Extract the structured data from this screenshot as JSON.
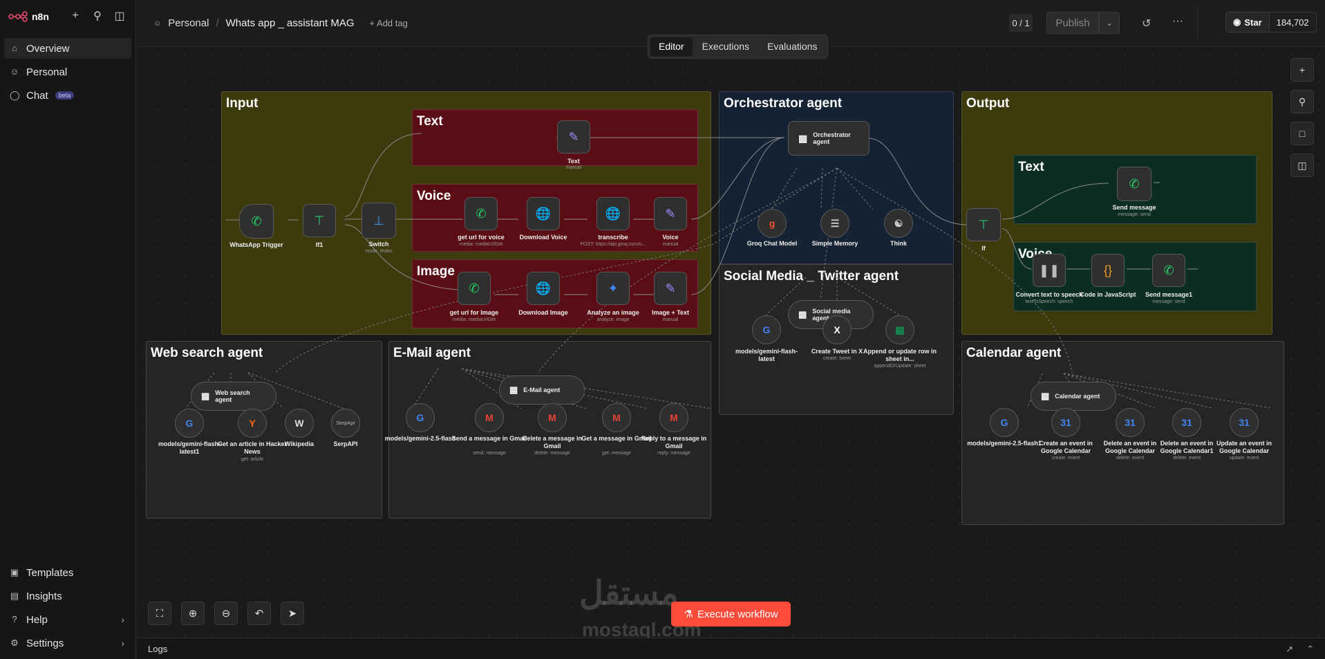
{
  "app": {
    "logo_text": "n8n"
  },
  "sidebar": {
    "items": [
      {
        "label": "Overview"
      },
      {
        "label": "Personal"
      },
      {
        "label": "Chat",
        "badge": "beta"
      }
    ],
    "bottom": [
      {
        "label": "Templates"
      },
      {
        "label": "Insights"
      },
      {
        "label": "Help"
      },
      {
        "label": "Settings"
      }
    ]
  },
  "header": {
    "project": "Personal",
    "workflow_title": "Whats app _ assistant MAG",
    "add_tag": "+ Add tag",
    "counter": "0 / 1",
    "publish": "Publish",
    "github_star": "Star",
    "github_count": "184,702"
  },
  "tabs": [
    {
      "label": "Editor"
    },
    {
      "label": "Executions"
    },
    {
      "label": "Evaluations"
    }
  ],
  "canvas": {
    "sections": {
      "input": "Input",
      "text": "Text",
      "voice": "Voice",
      "image": "Image",
      "orchestrator": "Orchestrator agent",
      "output": "Output",
      "out_text": "Text",
      "out_voice": "Voice",
      "social": "Social Media _ Twitter agent",
      "web": "Web search agent",
      "email": "E-Mail agent",
      "calendar": "Calendar agent"
    },
    "nodes": {
      "trigger": "WhatsApp Trigger",
      "if1": "If1",
      "switch": "Switch",
      "switch_sub": "mode: Rules",
      "text_node": "Text",
      "text_sub": "manual",
      "get_voice": "get url for voice",
      "get_voice_sub": "media: mediaUrlGet",
      "download_voice": "Download Voice",
      "transcribe": "transcribe",
      "transcribe_sub": "POST: https://api.groq.com/o...",
      "voice_node": "Voice",
      "voice_sub": "manual",
      "get_image": "get url for Image",
      "get_image_sub": "media: mediaUrlGet",
      "download_image": "Download Image",
      "analyze_image": "Analyze an image",
      "analyze_sub": "analyze: image",
      "image_text": "Image + Text",
      "image_text_sub": "manual",
      "orchestrator": "Orchestrator agent",
      "groq": "Groq Chat Model",
      "memory": "Simple Memory",
      "think": "Think",
      "out_if": "If",
      "send_message": "Send message",
      "send_message_sub": "message: send",
      "tts": "Convert text to speech",
      "tts_sub": "textToSpeech: speech",
      "code_js": "Code in JavaScript",
      "send_message1": "Send message1",
      "send_message1_sub": "message: send",
      "social_agent": "Social media agent",
      "social_model": "models/gemini-flash-latest",
      "tweet": "Create Tweet in X",
      "tweet_sub": "create: tweet",
      "sheet": "Append or update row in sheet in...",
      "sheet_sub": "appendOrUpdate: sheet",
      "web_agent": "Web search agent",
      "web_model": "models/gemini-flash-latest1",
      "hn": "Get an article in Hacker News",
      "hn_sub": "get: article",
      "wiki": "Wikipedia",
      "serp": "SerpAPI",
      "email_agent": "E-Mail agent",
      "email_model": "models/gemini-2.5-flash",
      "gmail_send": "Send a message in Gmail",
      "gmail_send_sub": "send: message",
      "gmail_delete": "Delete a message in Gmail",
      "gmail_delete_sub": "delete: message",
      "gmail_get": "Get a message in Gmail",
      "gmail_get_sub": "get: message",
      "gmail_reply": "Reply to a message in Gmail",
      "gmail_reply_sub": "reply: message",
      "cal_agent": "Calendar agent",
      "cal_model": "models/gemini-2.5-flash1",
      "cal_create": "Create an event in Google Calendar",
      "cal_create_sub": "create: event",
      "cal_delete": "Delete an event in Google Calendar",
      "cal_delete_sub": "delete: event",
      "cal_delete1": "Delete an event in Google Calendar1",
      "cal_delete1_sub": "delete: event",
      "cal_update": "Update an event in Google Calendar",
      "cal_update_sub": "update: event"
    }
  },
  "execute": "Execute workflow",
  "logs": "Logs",
  "watermark": {
    "line1": "مستقل",
    "line2": "mostaql.com"
  }
}
